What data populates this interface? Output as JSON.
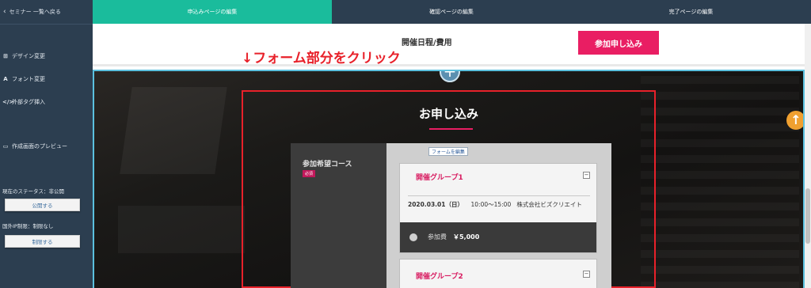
{
  "sidebar": {
    "back_label": "セミナー 一覧へ戻る",
    "items": [
      {
        "icon": "⊞",
        "label": "デザイン変更"
      },
      {
        "icon": "A",
        "label": "フォント変更"
      },
      {
        "icon": "</>",
        "label": "外部タグ挿入"
      },
      {
        "icon": "▭",
        "label": "作成画面のプレビュー"
      }
    ],
    "status_text": "現在のステータス：非公開",
    "publish_button": "公開する",
    "ip_restriction_text": "国外IP制限：制限なし",
    "restrict_button": "制限する"
  },
  "tabs": [
    {
      "label": "申込みページの編集",
      "active": true
    },
    {
      "label": "確認ページの編集",
      "active": false
    },
    {
      "label": "完了ページの編集",
      "active": false
    }
  ],
  "header": {
    "title": "開催日程/費用",
    "cta_label": "参加申し込み"
  },
  "annotation": "↓フォーム部分をクリック",
  "form": {
    "heading": "お申し込み",
    "edit_tag": "フォームを編集",
    "course_label": "参加希望コース",
    "required_badge": "必須",
    "groups": [
      {
        "title": "開催グループ1",
        "date": "2020.03.01（日）",
        "time": "10:00〜15:00",
        "organizer": "株式会社ビズクリエイト",
        "fee_label": "参加費",
        "fee_value": "￥5,000"
      },
      {
        "title": "開催グループ2"
      }
    ]
  },
  "colors": {
    "sidebar_bg": "#2c3e50",
    "active_tab": "#1abc9c",
    "accent_pink": "#e91e63",
    "annotation_red": "#e8212a"
  }
}
